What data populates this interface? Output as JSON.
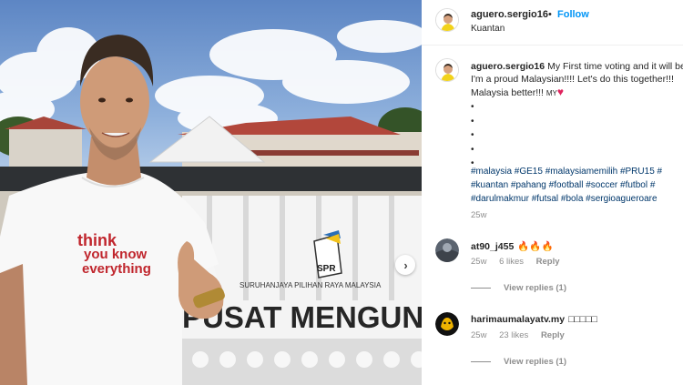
{
  "post": {
    "header": {
      "username": "aguero.sergio16",
      "separator": "•",
      "follow_label": "Follow",
      "location": "Kuantan"
    },
    "photo": {
      "shirt_text": [
        "think",
        "you know",
        "everything"
      ],
      "banner_subtitle": "SURUHANJAYA PILIHAN RAYA MALAYSIA",
      "banner_title": "PUSAT MENGUNDI",
      "logo_text": "SPR",
      "next_icon": "chevron-right-icon"
    },
    "caption": {
      "username": "aguero.sergio16",
      "line1": "My First time voting and it will be",
      "line2": "I'm a proud Malaysian!!!! Let's do this together!!!",
      "line3": "Malaysia better!!!",
      "line3_suffix": "MY",
      "bullets": [
        "•",
        "•",
        "•",
        "•",
        "•"
      ],
      "hashtag_lines": [
        "#malaysia #GE15 #malaysiamemilih #PRU15 #",
        "#kuantan #pahang #football #soccer #futbol #",
        "#darulmakmur #futsal #bola #sergioagueroare"
      ],
      "time": "25w"
    },
    "comments": [
      {
        "username": "at90_j455",
        "text": "🔥🔥🔥",
        "time": "25w",
        "likes": "6 likes",
        "reply_label": "Reply",
        "view_replies": "View replies (1)"
      },
      {
        "username": "harimaumalayatv.my",
        "text": "□□□□□",
        "time": "25w",
        "likes": "23 likes",
        "reply_label": "Reply",
        "view_replies": "View replies (1)"
      }
    ]
  },
  "colors": {
    "follow_blue": "#0095f6",
    "hashtag_blue": "#00376b",
    "heart_red": "#e0245e",
    "shirt_print_red": "#c0262d"
  }
}
